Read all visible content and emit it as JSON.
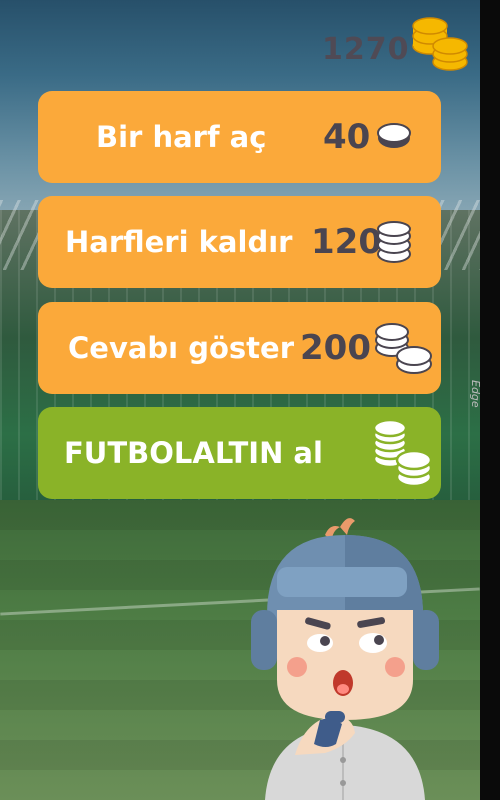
{
  "header": {
    "coins_value": "1270"
  },
  "buttons": [
    {
      "label": "Bir harf aç",
      "cost": "40"
    },
    {
      "label": "Harfleri kaldır",
      "cost": "120"
    },
    {
      "label": "Cevabı göster",
      "cost": "200"
    },
    {
      "label": "FUTBOLALTIN al"
    }
  ],
  "sidebar": {
    "edge_label": "Edge"
  },
  "colors": {
    "orange": "#fba93a",
    "green": "#8ab328",
    "coin": "#f5b800",
    "cost_text": "#4a4550"
  }
}
